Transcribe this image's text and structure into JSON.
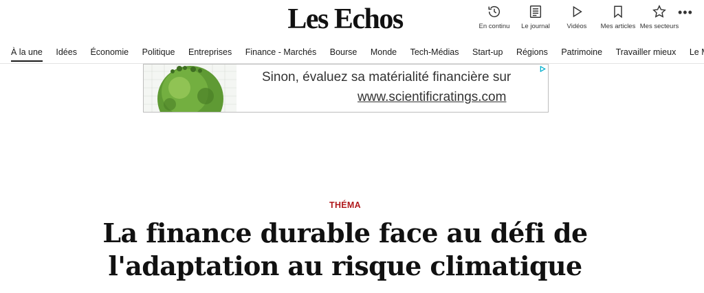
{
  "header": {
    "logo": "Les Echos",
    "tools": [
      {
        "label": "En continu",
        "icon": "clock-history-icon"
      },
      {
        "label": "Le journal",
        "icon": "newspaper-icon"
      },
      {
        "label": "Vidéos",
        "icon": "play-icon"
      },
      {
        "label": "Mes articles",
        "icon": "bookmark-icon"
      },
      {
        "label": "Mes secteurs",
        "icon": "star-icon"
      }
    ],
    "more_icon": "more-dots-icon"
  },
  "nav": {
    "items": [
      {
        "label": "À la une",
        "active": true
      },
      {
        "label": "Idées"
      },
      {
        "label": "Économie"
      },
      {
        "label": "Politique"
      },
      {
        "label": "Entreprises"
      },
      {
        "label": "Finance - Marchés"
      },
      {
        "label": "Bourse"
      },
      {
        "label": "Monde"
      },
      {
        "label": "Tech-Médias"
      },
      {
        "label": "Start-up"
      },
      {
        "label": "Régions"
      },
      {
        "label": "Patrimoine"
      },
      {
        "label": "Travailler mieux"
      },
      {
        "label": "Le Mag W-E"
      }
    ]
  },
  "ad": {
    "line1": "Sinon, évaluez sa matérialité financière sur",
    "line2": "www.scientificratings.com",
    "badge_icon": "adchoices-icon"
  },
  "article": {
    "rubric": "THÉMA",
    "title_line1": "La finance durable face au défi de",
    "title_line2": "l'adaptation au risque climatique"
  },
  "colors": {
    "accent": "#b0191c",
    "text": "#111111",
    "adchoices": "#00aecd"
  }
}
